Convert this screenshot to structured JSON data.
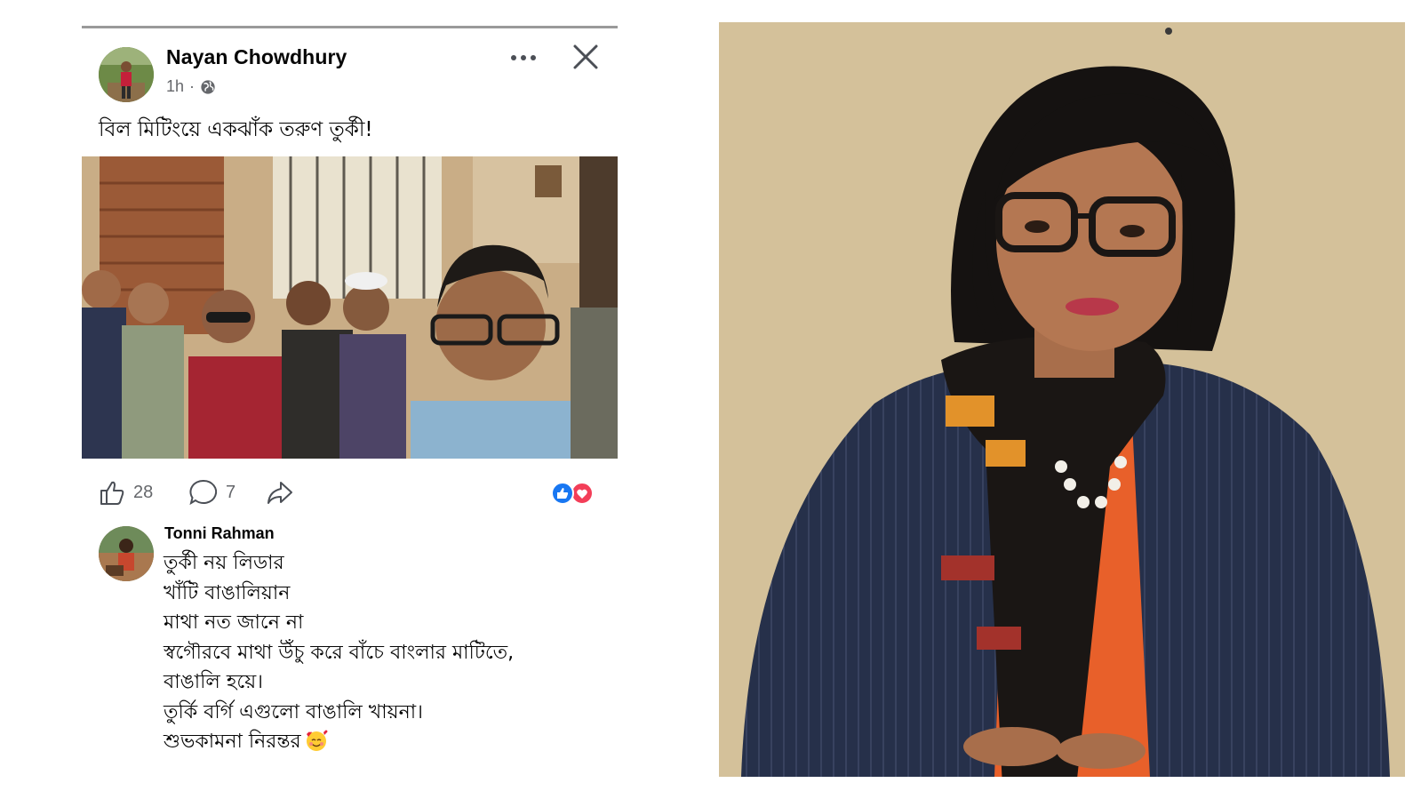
{
  "post": {
    "author": "Nayan Chowdhury",
    "time": "1h",
    "separator": "·",
    "text": "বিল মিটিংয়ে একঝাঁক তরুণ তুর্কী!",
    "likes": "28",
    "comments": "7",
    "icons": {
      "more": "more-dots-icon",
      "close": "close-icon",
      "audience": "globe-icon",
      "like": "thumbs-up-icon",
      "comment": "comment-bubble-icon",
      "share": "share-arrow-icon",
      "reactions": [
        "like-reaction-icon",
        "love-reaction-icon"
      ]
    }
  },
  "comment": {
    "author": "Tonni Rahman",
    "lines": [
      "তুর্কী নয় লিডার",
      "খাঁটি বাঙালিয়ান",
      "মাথা নত জানে না",
      "স্বগৌরবে মাথা উঁচু করে বাঁচে বাংলার মাটিতে,",
      "বাঙালি হয়ে।",
      "তুর্কি বর্গি এগুলো বাঙালি খায়না।",
      "শুভকামনা নিরন্তর"
    ],
    "emoji": "smiling-face-with-hearts-icon"
  },
  "colors": {
    "like_blue": "#1877f2",
    "love_red": "#f33e58",
    "meta_gray": "#65676b",
    "photo_wall": "#d8c59f",
    "blazer": "#26304a",
    "top_orange": "#e8602a"
  }
}
